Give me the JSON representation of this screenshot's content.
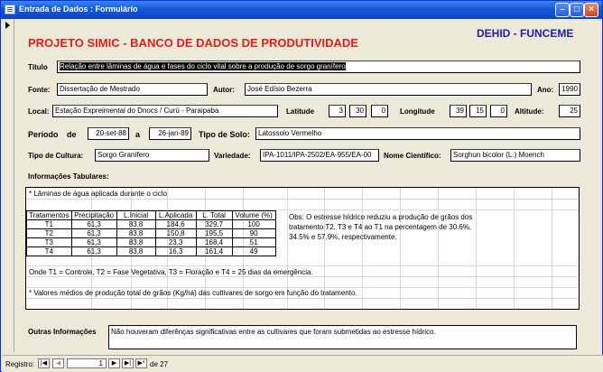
{
  "window": {
    "title": "Entrada de Dados : Formulário"
  },
  "header": {
    "title": "PROJETO SIMIC - BANCO DE DADOS DE PRODUTIVIDADE",
    "org": "DEHID - FUNCEME"
  },
  "form": {
    "titulo_label": "Título",
    "titulo_value": "Relação entre lâminas de água e fases do ciclo vital sobre a produção de sorgo granífero",
    "fonte_label": "Fonte:",
    "fonte_value": "Dissertação de Mestrado",
    "autor_label": "Autor:",
    "autor_value": "José Edísio Bezerra",
    "ano_label": "Ano:",
    "ano_value": "1990",
    "local_label": "Local:",
    "local_value": "Estação Expreimental do Dnocs / Curú - Paraipaba",
    "latitude_label": "Latitude",
    "latitude_deg": "3",
    "latitude_min": "30",
    "latitude_sec": "0",
    "longitude_label": "Longitude",
    "longitude_deg": "39",
    "longitude_min": "15",
    "longitude_sec": "0",
    "altitude_label": "Altitude:",
    "altitude_value": "25",
    "periodo_label": "Período",
    "periodo_de": "de",
    "periodo_start": "20-set-88",
    "periodo_a": "a",
    "periodo_end": "26-jan-89",
    "solo_label": "Tipo de Solo:",
    "solo_value": "Latossolo Vermelho",
    "cultura_label": "Tipo de Cultura:",
    "cultura_value": "Sorgo Granífero",
    "variedade_label": "Variedade:",
    "variedade_value": "IPA-1011/IPA-2502/EA-955/EA-00",
    "cientifico_label": "Nome Científico:",
    "cientifico_value": "Sorghun bicolor (L.) Moench",
    "info_label": "Informações Tabulares:",
    "outras_label": "Outras Informações",
    "outras_value": "Não houveram diferênças significativas entre as cultivares que foram submetidas ao estresse hídrico."
  },
  "tab": {
    "caption": "* Lâminas de água aplicada durante o ciclo",
    "headers": [
      "Tratamentos",
      "Precipitação",
      "L.Inicial",
      "L.Aplicada",
      "L. Total",
      "Volume (%)"
    ],
    "rows": [
      [
        "T1",
        "61,3",
        "83,8",
        "184,6",
        "329,7",
        "100"
      ],
      [
        "T2",
        "61,3",
        "83,8",
        "150,8",
        "195,5",
        "90"
      ],
      [
        "T3",
        "61,3",
        "83,8",
        "23,3",
        "168,4",
        "51"
      ],
      [
        "T4",
        "61,3",
        "83,8",
        "16,3",
        "161,4",
        "49"
      ]
    ],
    "obs_lines": [
      "Obs: O estresse hídrico reduziu a produção de grãos dos",
      "tratamento T2, T3 e T4 ao T1 na percentagem de 30.6%,",
      "34.5% e 57.9%, respectivamente."
    ],
    "legend": "Onde T1 = Controle, T2 = Fase Vegetativa, T3 = Floração e T4 = 25 dias da emergência.",
    "footnote": "* Valores médios de produção total de grãos (Kg/há) das cultivares de sorgo em função do tratamento."
  },
  "nav": {
    "label": "Registro:",
    "current": "1",
    "of_text": "de  27"
  }
}
